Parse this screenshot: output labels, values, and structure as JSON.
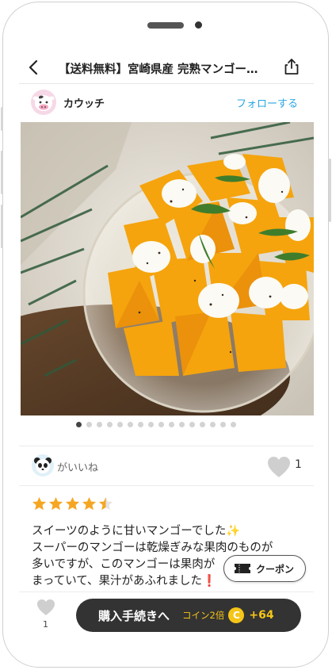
{
  "header": {
    "title": "【送料無料】宮崎県産 完熟マンゴー…"
  },
  "author": {
    "name": "カウッチ",
    "follow_label": "フォローする"
  },
  "carousel": {
    "total": 16,
    "active": 0
  },
  "likes": {
    "label": "がいいね",
    "count": "1"
  },
  "rating": {
    "value": 4.5,
    "max": 5
  },
  "review": {
    "lines": [
      "スイーツのように甘いマンゴーでした✨",
      "スーパーのマンゴーは乾燥ぎみな果肉のものが",
      "多いですが、このマンゴーは果肉が",
      "まっていて、果汁があふれました❗"
    ]
  },
  "coupon": {
    "label": "クーポン"
  },
  "bottom_bar": {
    "like_count": "1",
    "buy_label": "購入手続きへ",
    "coin_label": "コイン2倍",
    "coin_symbol": "C",
    "coin_amount": "+64"
  },
  "colors": {
    "accent": "#2aa6e3",
    "coin": "#f5c518",
    "star": "#f5a623",
    "button_dark": "#333333"
  }
}
